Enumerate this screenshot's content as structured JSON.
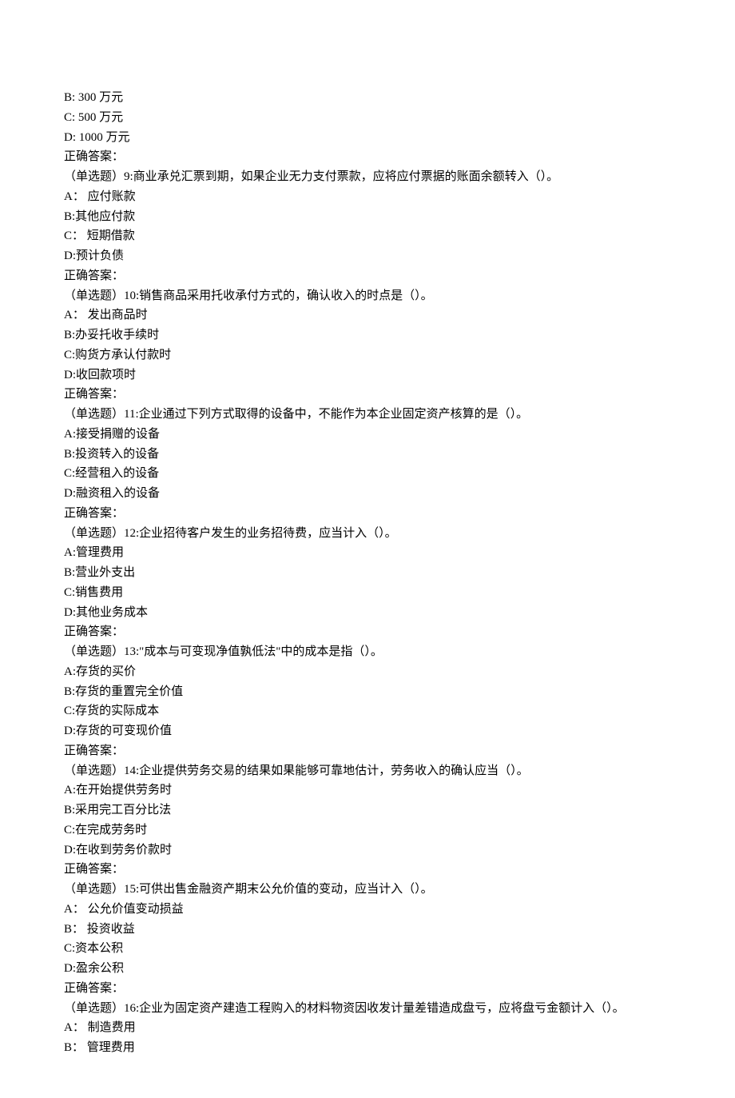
{
  "lines": [
    "B: 300 万元",
    "C: 500 万元",
    "D: 1000 万元",
    "正确答案：",
    "（单选题）9:商业承兑汇票到期，如果企业无力支付票款，应将应付票据的账面余额转入（）。",
    "A： 应付账款",
    "B:其他应付款",
    "C： 短期借款",
    "D:预计负债",
    "正确答案：",
    "（单选题）10:销售商品采用托收承付方式的，确认收入的时点是（）。",
    "A： 发出商品时",
    "B:办妥托收手续时",
    "C:购货方承认付款时",
    "D:收回款项时",
    "正确答案：",
    "（单选题）11:企业通过下列方式取得的设备中，不能作为本企业固定资产核算的是（）。",
    "A:接受捐赠的设备",
    "B:投资转入的设备",
    "C:经营租入的设备",
    "D:融资租入的设备",
    "正确答案：",
    "（单选题）12:企业招待客户发生的业务招待费，应当计入（）。",
    "A:管理费用",
    "B:营业外支出",
    "C:销售费用",
    "D:其他业务成本",
    "正确答案：",
    "（单选题）13:\"成本与可变现净值孰低法\"中的成本是指（）。",
    "A:存货的买价",
    "B:存货的重置完全价值",
    "C:存货的实际成本",
    "D:存货的可变现价值",
    "正确答案：",
    "（单选题）14:企业提供劳务交易的结果如果能够可靠地估计，劳务收入的确认应当（）。",
    "A:在开始提供劳务时",
    "B:采用完工百分比法",
    "C:在完成劳务时",
    "D:在收到劳务价款时",
    "正确答案：",
    "（单选题）15:可供出售金融资产期末公允价值的变动，应当计入（）。",
    "A： 公允价值变动损益",
    "B： 投资收益",
    "C:资本公积",
    "D:盈余公积",
    "正确答案：",
    "（单选题）16:企业为固定资产建造工程购入的材料物资因收发计量差错造成盘亏，应将盘亏金额计入（）。",
    "A： 制造费用",
    "B： 管理费用"
  ]
}
